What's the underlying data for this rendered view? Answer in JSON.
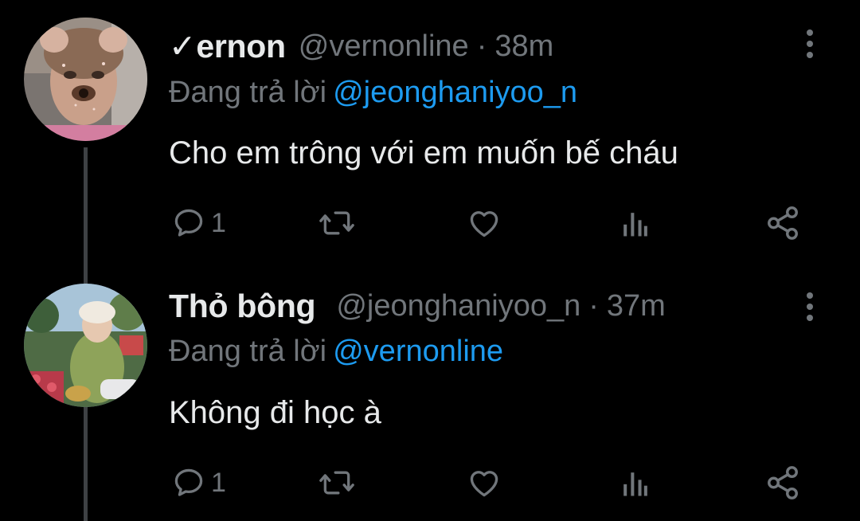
{
  "tweets": [
    {
      "verified_mark": "✓",
      "display_name": "ernon",
      "handle": "@vernonline",
      "separator": "·",
      "time": "38m",
      "reply_prefix": "Đang trả lời",
      "reply_to": "@jeonghaniyoo_n",
      "text": "Cho em trông với em muốn bế cháu",
      "reply_count": "1",
      "avatar_icon": "user-avatar-photo"
    },
    {
      "verified_mark": "",
      "display_name": "Thỏ bông",
      "handle": "@jeonghaniyoo_n",
      "separator": "·",
      "time": "37m",
      "reply_prefix": "Đang trả lời",
      "reply_to": "@vernonline",
      "text": "Không đi học à",
      "reply_count": "1",
      "avatar_icon": "user-avatar-photo"
    }
  ],
  "colors": {
    "background": "#000000",
    "primary_text": "#e7e9ea",
    "secondary_text": "#71767b",
    "link": "#1d9bf0",
    "thread_line": "#3e4144"
  },
  "icons": {
    "reply": "reply-icon",
    "retweet": "retweet-icon",
    "like": "heart-icon",
    "views": "analytics-icon",
    "share": "share-icon",
    "more": "more-vertical-icon"
  }
}
